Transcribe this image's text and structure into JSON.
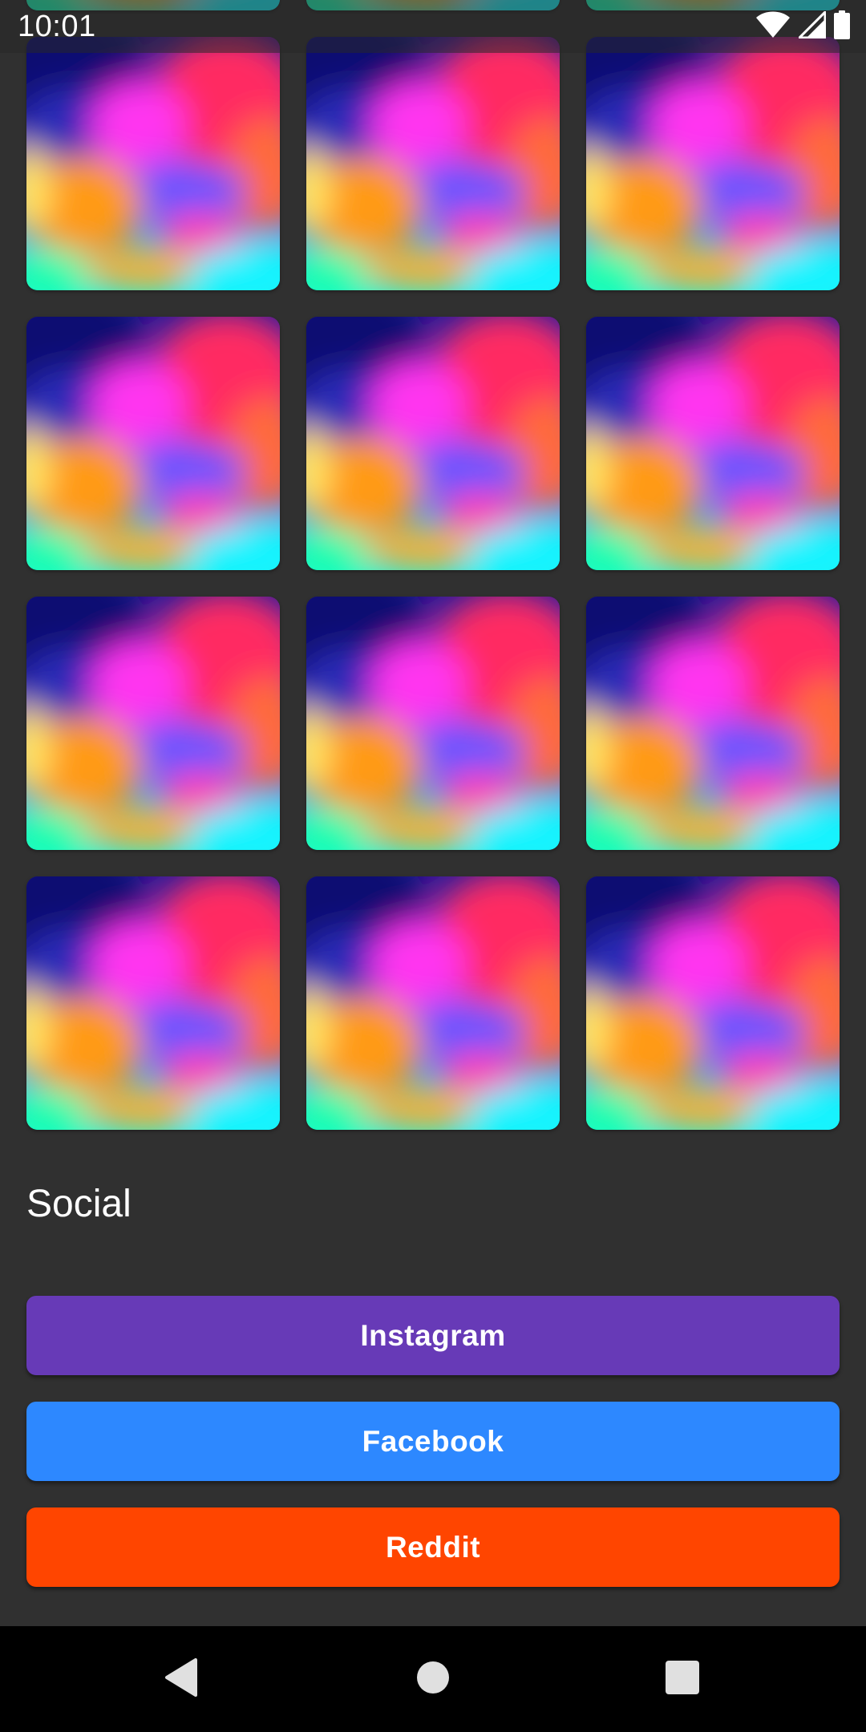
{
  "status_bar": {
    "time": "10:01",
    "icons": [
      "wifi-icon",
      "cell-signal-icon",
      "battery-icon"
    ]
  },
  "grid": {
    "tile_count": 15,
    "tile_image": "abstract-gradient-wallpaper"
  },
  "social": {
    "title": "Social",
    "buttons": [
      {
        "label": "Instagram",
        "color": "#673AB7"
      },
      {
        "label": "Facebook",
        "color": "#2D88FF"
      },
      {
        "label": "Reddit",
        "color": "#FF4500"
      }
    ]
  },
  "nav_bar": {
    "icons": [
      "back-icon",
      "home-icon",
      "recents-icon"
    ]
  },
  "colors": {
    "background": "#303030",
    "text": "#FFFFFF",
    "nav_background": "#000000"
  }
}
